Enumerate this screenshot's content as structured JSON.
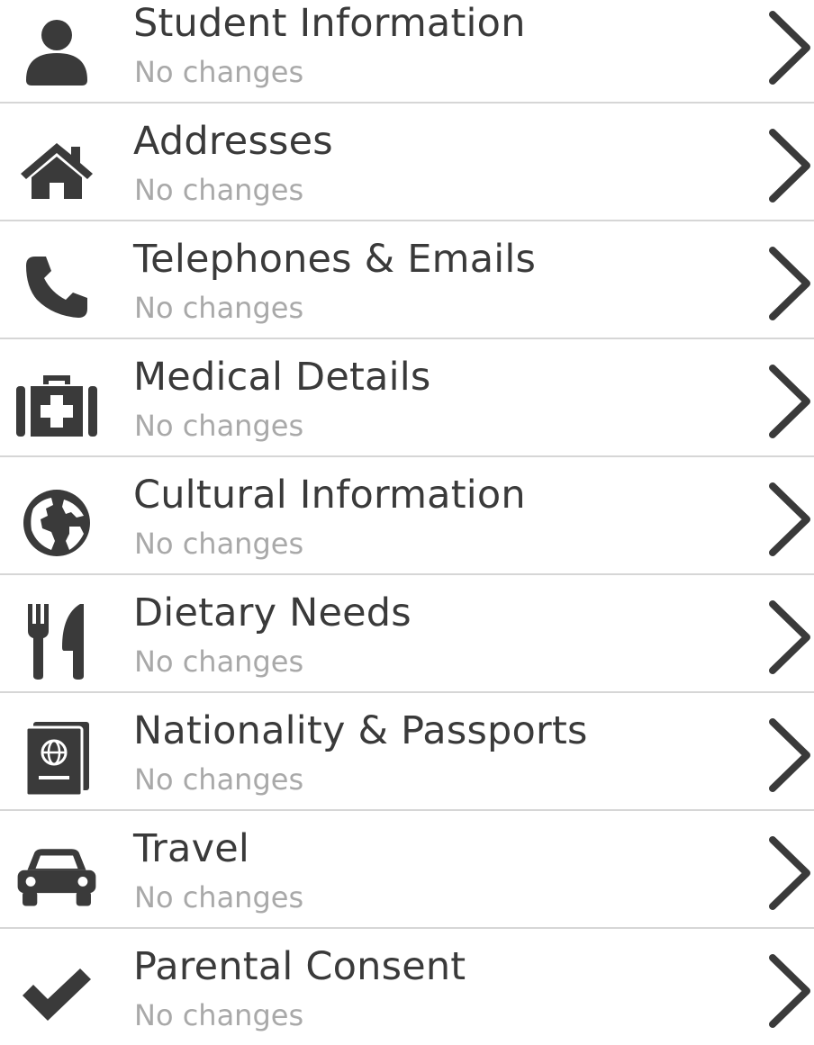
{
  "colors": {
    "icon": "#3a3a3a",
    "title": "#3a3a3a",
    "status": "#a9a9a9",
    "divider": "#d6d6d6",
    "chevron": "#3a3a3a"
  },
  "sections": [
    {
      "title": "Student Information",
      "status": "No changes",
      "icon": "user-icon"
    },
    {
      "title": "Addresses",
      "status": "No changes",
      "icon": "home-icon"
    },
    {
      "title": "Telephones & Emails",
      "status": "No changes",
      "icon": "phone-icon"
    },
    {
      "title": "Medical Details",
      "status": "No changes",
      "icon": "medkit-icon"
    },
    {
      "title": "Cultural Information",
      "status": "No changes",
      "icon": "globe-icon"
    },
    {
      "title": "Dietary Needs",
      "status": "No changes",
      "icon": "cutlery-icon"
    },
    {
      "title": "Nationality & Passports",
      "status": "No changes",
      "icon": "passport-icon"
    },
    {
      "title": "Travel",
      "status": "No changes",
      "icon": "car-icon"
    },
    {
      "title": "Parental Consent",
      "status": "No changes",
      "icon": "check-icon"
    }
  ]
}
